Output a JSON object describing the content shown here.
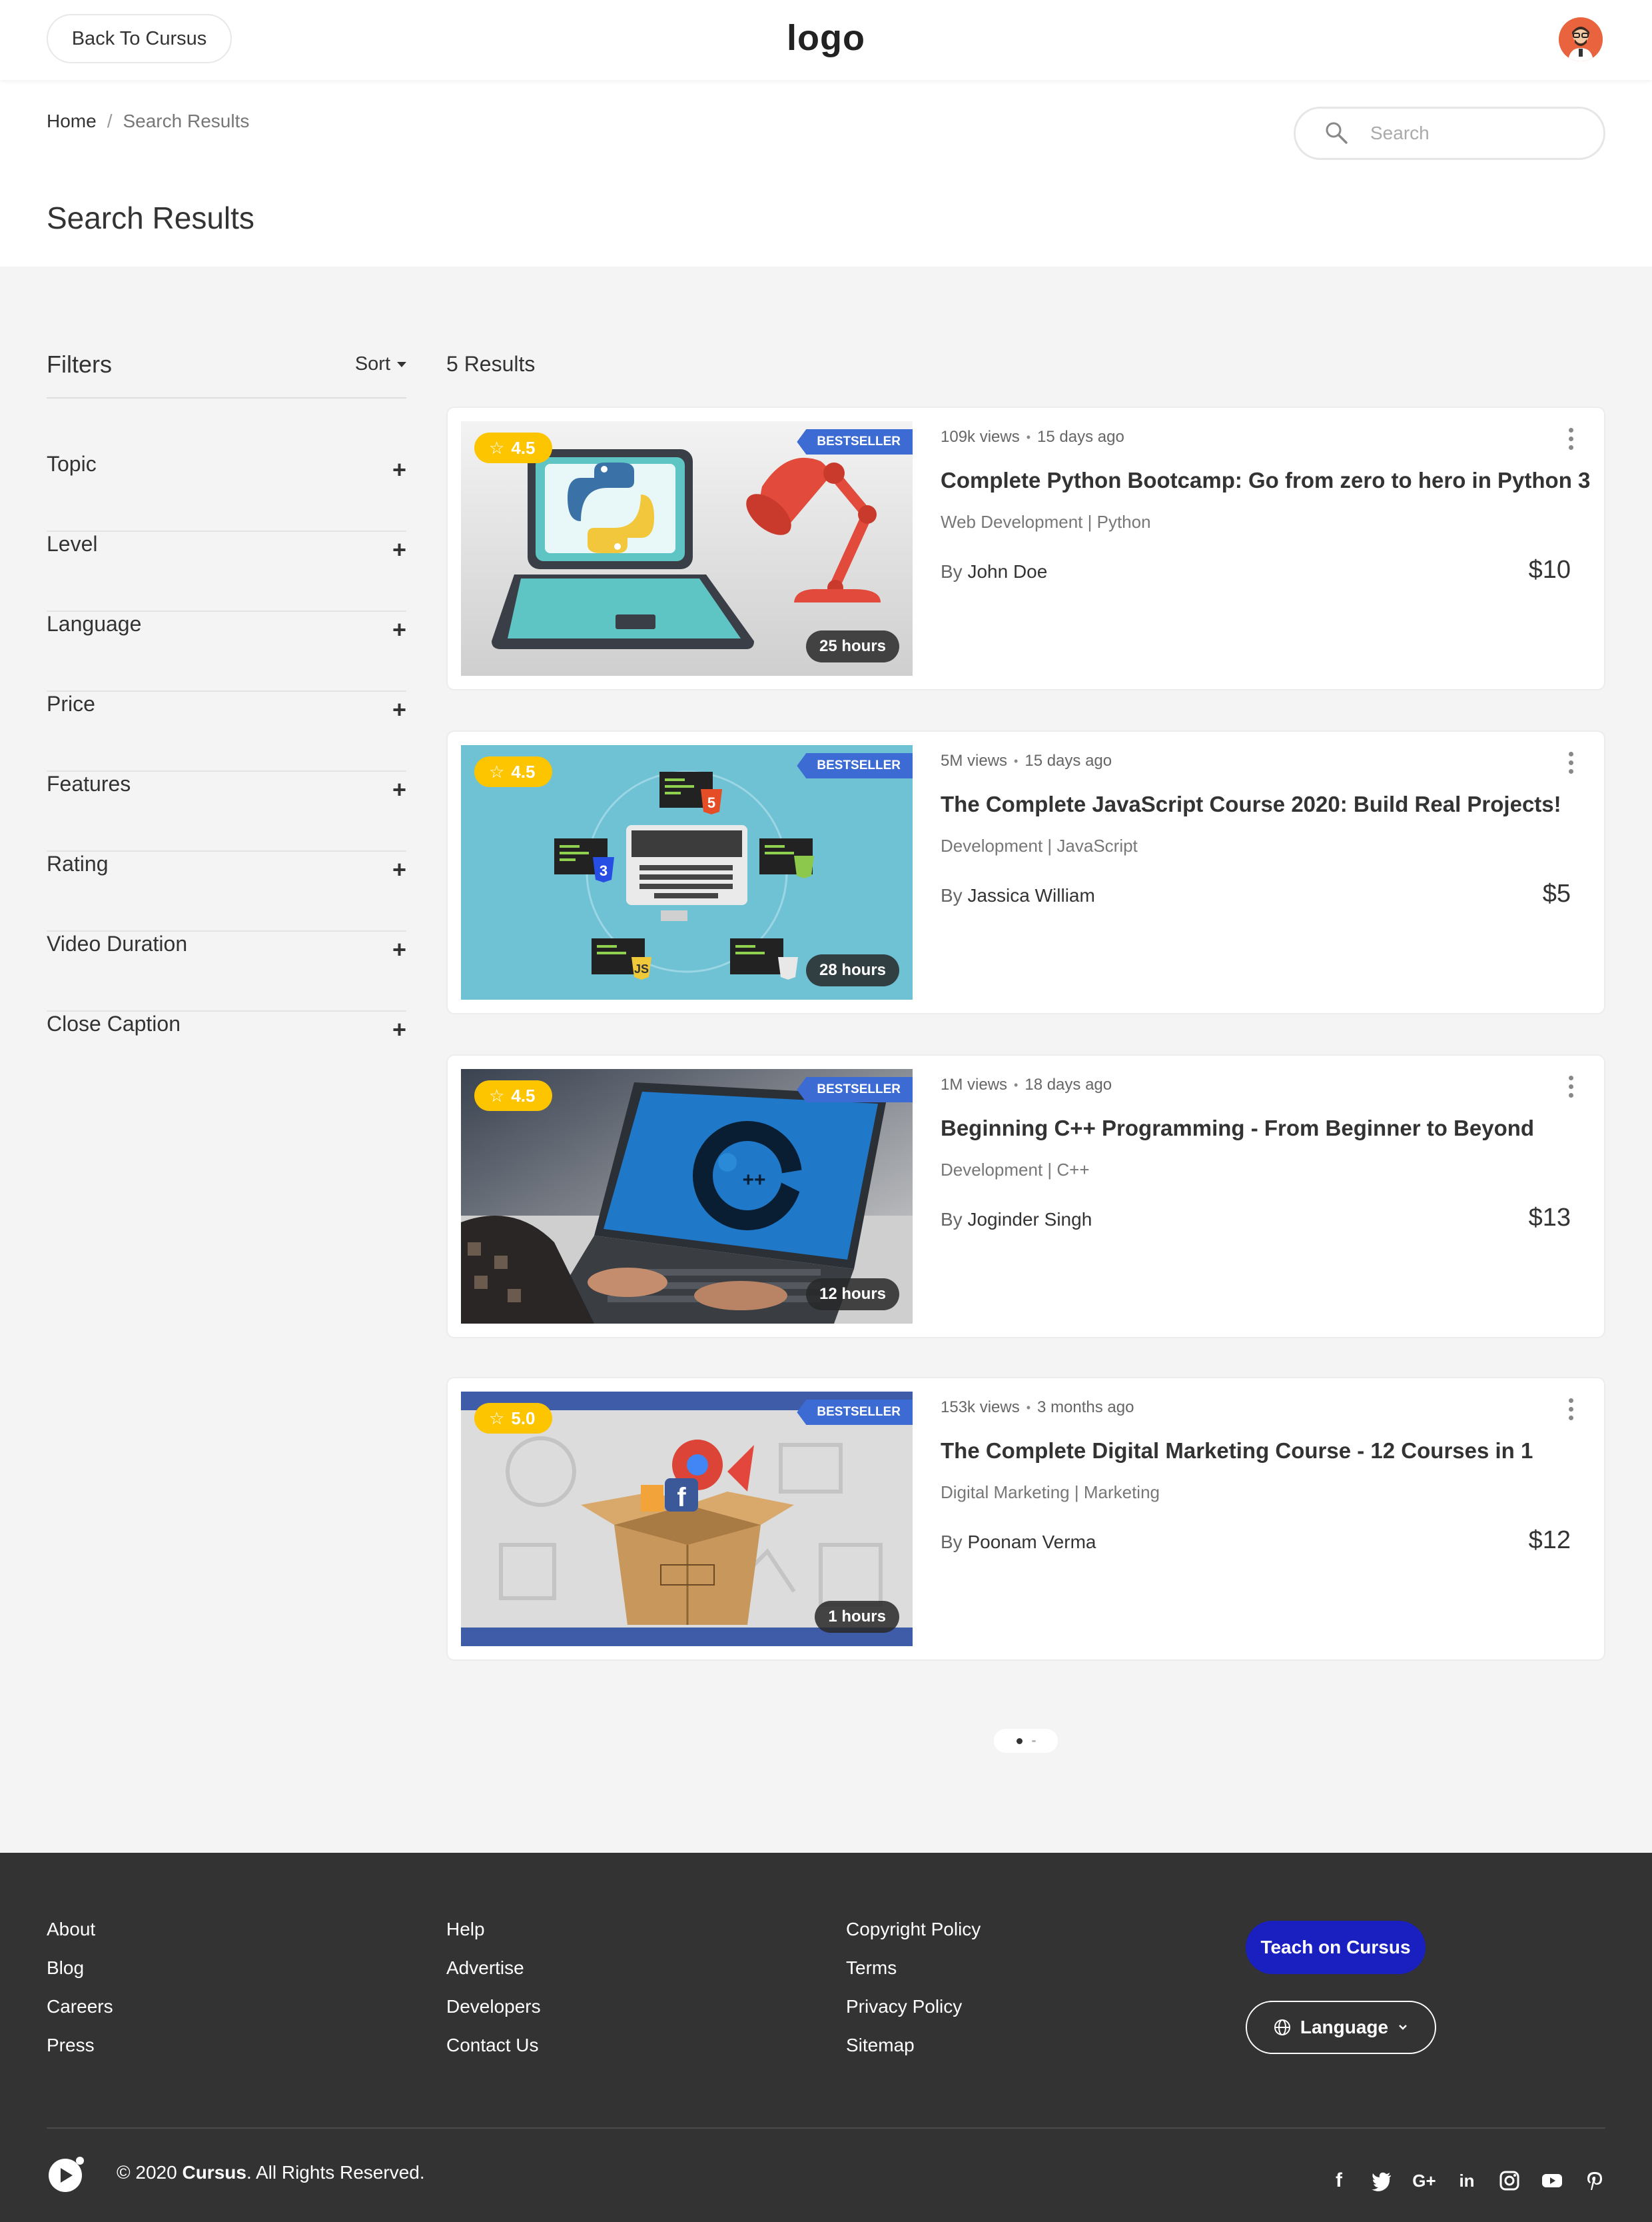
{
  "header": {
    "back_label": "Back To Cursus",
    "logo_text": "logo"
  },
  "breadcrumb": {
    "home": "Home",
    "separator": "/",
    "current": "Search Results"
  },
  "search": {
    "placeholder": "Search",
    "value": ""
  },
  "page_title": "Search Results",
  "filters": {
    "title": "Filters",
    "sort_label": "Sort",
    "items": [
      {
        "label": "Topic",
        "icon": "+"
      },
      {
        "label": "Level",
        "icon": "+"
      },
      {
        "label": "Language",
        "icon": "+"
      },
      {
        "label": "Price",
        "icon": "+"
      },
      {
        "label": "Features",
        "icon": "+"
      },
      {
        "label": "Rating",
        "icon": "+"
      },
      {
        "label": "Video Duration",
        "icon": "+"
      },
      {
        "label": "Close Caption",
        "icon": "+"
      }
    ]
  },
  "results": {
    "count_label": "5 Results",
    "courses": [
      {
        "rating": "4.5",
        "badge": "BESTSELLER",
        "duration": "25 hours",
        "views": "109k views",
        "dot": "•",
        "posted": "15 days ago",
        "title": "Complete Python Bootcamp: Go from zero to hero in Python 3",
        "category": "Web Development | Python",
        "by": "By",
        "author": "John Doe",
        "price": "$10"
      },
      {
        "rating": "4.5",
        "badge": "BESTSELLER",
        "duration": "28 hours",
        "views": "5M views",
        "dot": "•",
        "posted": "15 days ago",
        "title": "The Complete JavaScript Course 2020: Build Real Projects!",
        "category": "Development | JavaScript",
        "by": "By",
        "author": "Jassica William",
        "price": "$5"
      },
      {
        "rating": "4.5",
        "badge": "BESTSELLER",
        "duration": "12 hours",
        "views": "1M views",
        "dot": "•",
        "posted": "18 days ago",
        "title": "Beginning C++ Programming - From Beginner to Beyond",
        "category": "Development | C++",
        "by": "By",
        "author": "Joginder Singh",
        "price": "$13"
      },
      {
        "rating": "5.0",
        "badge": "BESTSELLER",
        "duration": "1 hours",
        "views": "153k views",
        "dot": "•",
        "posted": "3 months ago",
        "title": "The Complete Digital Marketing Course - 12 Courses in 1",
        "category": "Digital Marketing | Marketing",
        "by": "By",
        "author": "Poonam Verma",
        "price": "$12"
      }
    ]
  },
  "footer": {
    "col1": [
      "About",
      "Blog",
      "Careers",
      "Press"
    ],
    "col2": [
      "Help",
      "Advertise",
      "Developers",
      "Contact Us"
    ],
    "col3": [
      "Copyright Policy",
      "Terms",
      "Privacy Policy",
      "Sitemap"
    ],
    "teach_label": "Teach on Cursus",
    "language_label": "Language",
    "copyright_prefix": "© 2020",
    "brand": "Cursus",
    "copyright_suffix": ". All Rights Reserved.",
    "socials": [
      "facebook-icon",
      "twitter-icon",
      "google-plus-icon",
      "linkedin-icon",
      "instagram-icon",
      "youtube-icon",
      "pinterest-icon"
    ]
  },
  "colors": {
    "accent_blue": "#1a1fbf",
    "rating_yellow": "#fdc400",
    "badge_blue": "#3c6bd4",
    "footer_bg": "#333333"
  }
}
